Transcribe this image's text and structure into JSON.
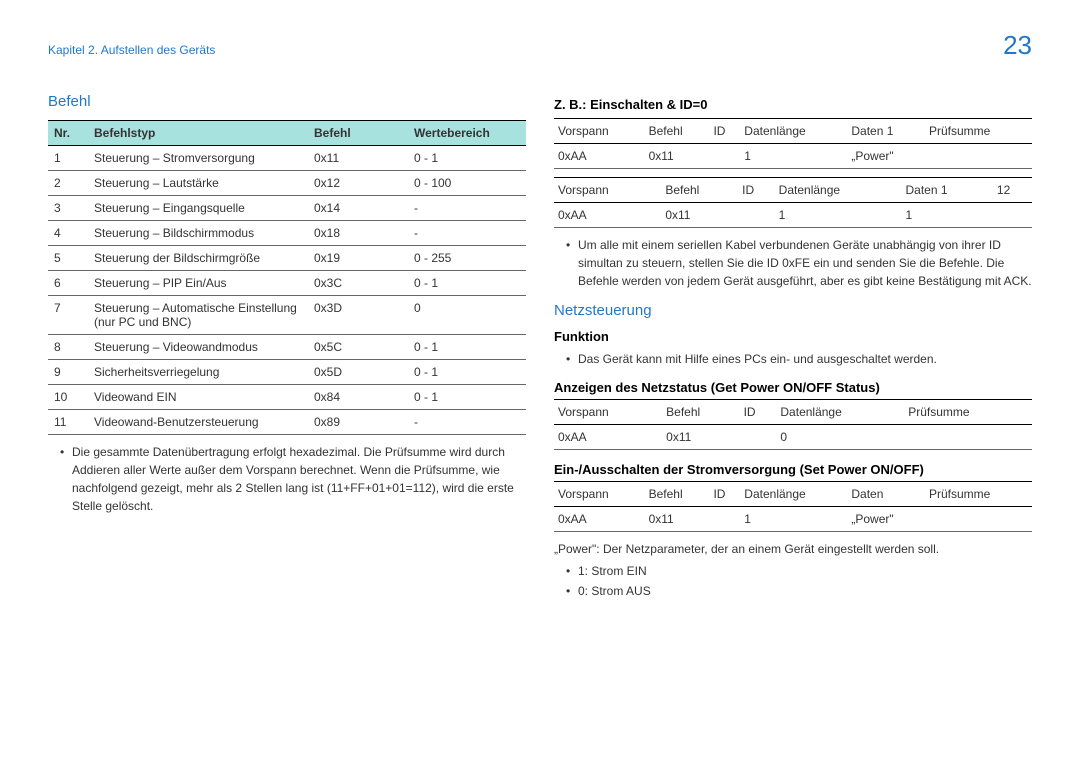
{
  "header": {
    "chapter": "Kapitel 2. Aufstellen des Geräts",
    "page_number": "23"
  },
  "left": {
    "section_title": "Befehl",
    "table": {
      "headers": {
        "nr": "Nr.",
        "typ": "Befehlstyp",
        "befehl": "Befehl",
        "werte": "Wertebereich"
      },
      "rows": [
        {
          "nr": "1",
          "typ": "Steuerung – Stromversorgung",
          "befehl": "0x11",
          "werte": "0 - 1"
        },
        {
          "nr": "2",
          "typ": "Steuerung – Lautstärke",
          "befehl": "0x12",
          "werte": "0 - 100"
        },
        {
          "nr": "3",
          "typ": "Steuerung – Eingangsquelle",
          "befehl": "0x14",
          "werte": "-"
        },
        {
          "nr": "4",
          "typ": "Steuerung – Bildschirmmodus",
          "befehl": "0x18",
          "werte": "-"
        },
        {
          "nr": "5",
          "typ": "Steuerung der Bildschirmgröße",
          "befehl": "0x19",
          "werte": "0 - 255"
        },
        {
          "nr": "6",
          "typ": "Steuerung – PIP Ein/Aus",
          "befehl": "0x3C",
          "werte": "0 - 1"
        },
        {
          "nr": "7",
          "typ": "Steuerung – Automatische Einstellung (nur PC und BNC)",
          "befehl": "0x3D",
          "werte": "0"
        },
        {
          "nr": "8",
          "typ": "Steuerung – Videowandmodus",
          "befehl": "0x5C",
          "werte": "0 - 1"
        },
        {
          "nr": "9",
          "typ": "Sicherheitsverriegelung",
          "befehl": "0x5D",
          "werte": "0 - 1"
        },
        {
          "nr": "10",
          "typ": "Videowand EIN",
          "befehl": "0x84",
          "werte": "0 - 1"
        },
        {
          "nr": "11",
          "typ": "Videowand-Benutzersteuerung",
          "befehl": "0x89",
          "werte": "-"
        }
      ]
    },
    "note": "Die gesammte Datenübertragung erfolgt hexadezimal. Die Prüfsumme wird durch Addieren aller Werte außer dem Vorspann berechnet. Wenn die Prüfsumme, wie nachfolgend gezeigt, mehr als 2 Stellen lang ist (11+FF+01+01=112), wird die erste Stelle gelöscht."
  },
  "right": {
    "example_title": "Z. B.: Einschalten & ID=0",
    "tbl1": {
      "h": {
        "c1": "Vorspann",
        "c2": "Befehl",
        "c3": "ID",
        "c4": "Datenlänge",
        "c5": "Daten 1",
        "c6": "Prüfsumme"
      },
      "r": {
        "c1": "0xAA",
        "c2": "0x11",
        "c3": "",
        "c4": "1",
        "c5": "„Power\"",
        "c6": ""
      }
    },
    "tbl2": {
      "h": {
        "c1": "Vorspann",
        "c2": "Befehl",
        "c3": "ID",
        "c4": "Datenlänge",
        "c5": "Daten 1",
        "c6": "12"
      },
      "r": {
        "c1": "0xAA",
        "c2": "0x11",
        "c3": "",
        "c4": "1",
        "c5": "1",
        "c6": ""
      }
    },
    "note1": "Um alle mit einem seriellen Kabel verbundenen Geräte unabhängig von ihrer ID simultan zu steuern, stellen Sie die ID 0xFE ein und senden Sie die Befehle. Die Befehle werden von jedem Gerät ausgeführt, aber es gibt keine Bestätigung mit ACK.",
    "netz_title": "Netzsteuerung",
    "funktion_label": "Funktion",
    "funktion_text": "Das Gerät kann mit Hilfe eines PCs ein- und ausgeschaltet werden.",
    "status_title": "Anzeigen des Netzstatus (Get Power ON/OFF Status)",
    "tbl3": {
      "h": {
        "c1": "Vorspann",
        "c2": "Befehl",
        "c3": "ID",
        "c4": "Datenlänge",
        "c5": "Prüfsumme"
      },
      "r": {
        "c1": "0xAA",
        "c2": "0x11",
        "c3": "",
        "c4": "0",
        "c5": ""
      }
    },
    "onoff_title": "Ein-/Ausschalten der Stromversorgung (Set Power ON/OFF)",
    "tbl4": {
      "h": {
        "c1": "Vorspann",
        "c2": "Befehl",
        "c3": "ID",
        "c4": "Datenlänge",
        "c5": "Daten",
        "c6": "Prüfsumme"
      },
      "r": {
        "c1": "0xAA",
        "c2": "0x11",
        "c3": "",
        "c4": "1",
        "c5": "„Power\"",
        "c6": ""
      }
    },
    "power_note": "„Power\": Der Netzparameter, der an einem Gerät eingestellt werden soll.",
    "bullets": {
      "a": "1: Strom EIN",
      "b": "0: Strom AUS"
    }
  }
}
